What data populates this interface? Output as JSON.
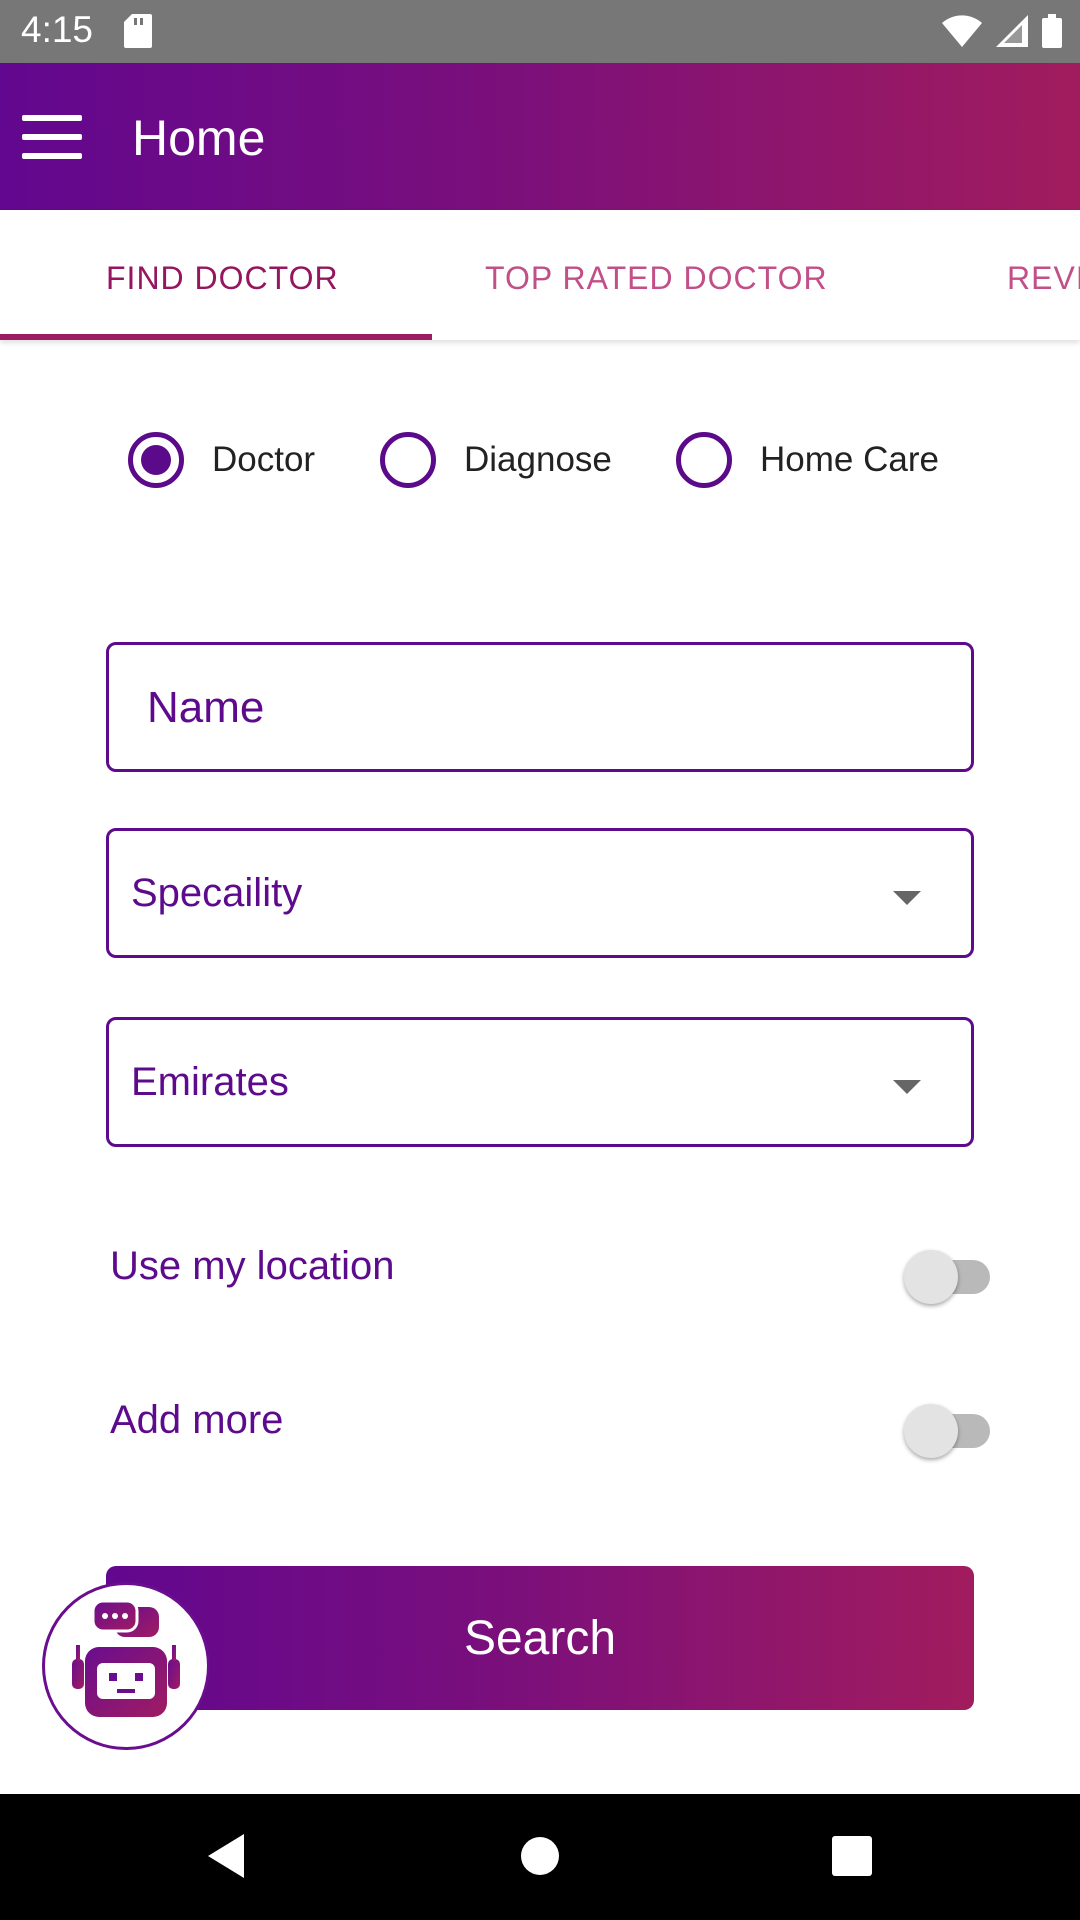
{
  "status_bar": {
    "time": "4:15"
  },
  "app_bar": {
    "title": "Home"
  },
  "tabs": [
    {
      "label": "FIND DOCTOR",
      "active": true
    },
    {
      "label": "TOP RATED DOCTOR",
      "active": false
    },
    {
      "label": "REVI",
      "active": false
    }
  ],
  "search_type": {
    "options": [
      {
        "label": "Doctor",
        "selected": true
      },
      {
        "label": "Diagnose",
        "selected": false
      },
      {
        "label": "Home Care",
        "selected": false
      }
    ]
  },
  "form": {
    "name_placeholder": "Name",
    "speciality_value": "Specaility",
    "emirates_value": "Emirates",
    "use_location_label": "Use my location",
    "use_location_on": false,
    "add_more_label": "Add more",
    "add_more_on": false,
    "search_label": "Search"
  },
  "colors": {
    "brand_purple": "#5d0b8c",
    "gradient_start": "#62078f",
    "gradient_end": "#a11c5e",
    "tab_accent": "#9c1c63"
  },
  "icons": {
    "menu": "hamburger-menu-icon",
    "bot": "chatbot-robot-icon",
    "nav_back": "back-triangle-icon",
    "nav_home": "home-circle-icon",
    "nav_recents": "recents-square-icon"
  }
}
